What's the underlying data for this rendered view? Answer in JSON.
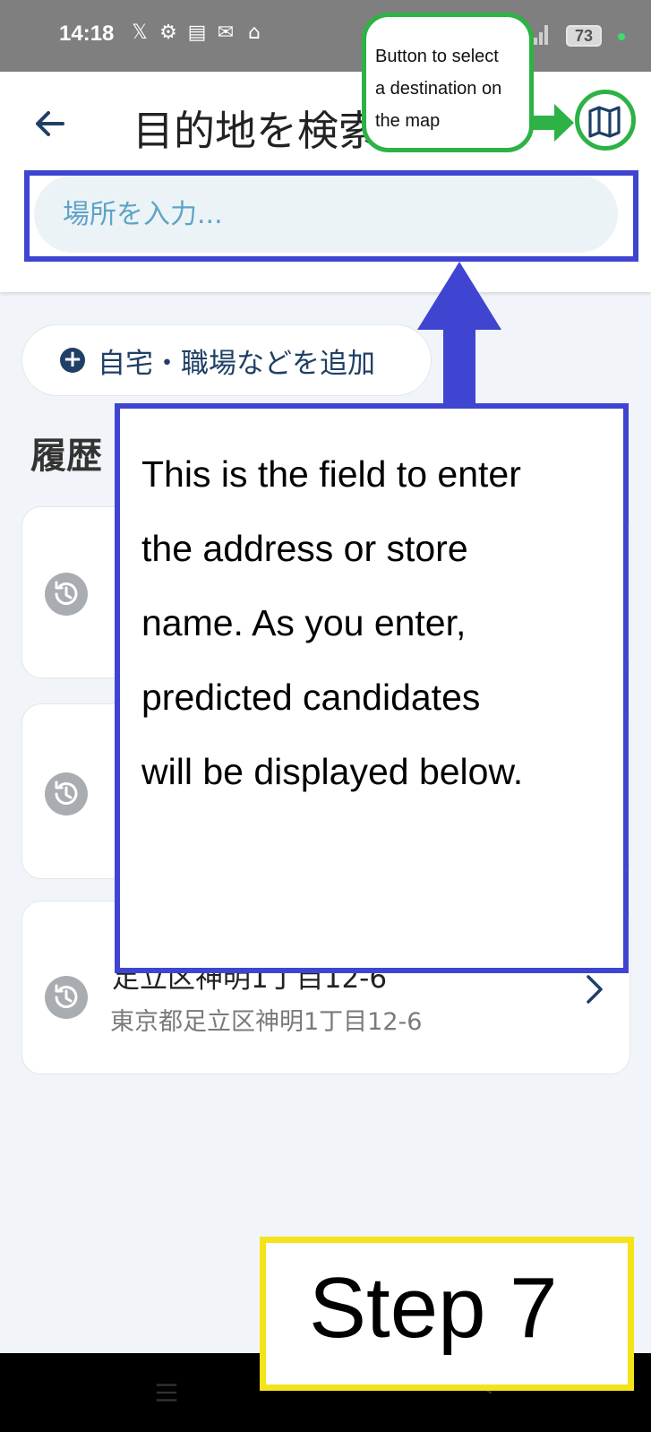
{
  "status_bar": {
    "time": "14:18",
    "icons": [
      "x-icon",
      "settings-icon",
      "sim-icon",
      "mail-icon",
      "vpn-icon"
    ],
    "battery": "73"
  },
  "header": {
    "title": "目的地を検索",
    "search_placeholder": "場所を入力..."
  },
  "content": {
    "add_place_label": "自宅・職場などを追加",
    "history_title": "履歴",
    "history_items": [
      {
        "primary": "",
        "secondary": ""
      },
      {
        "primary": "",
        "secondary": ""
      },
      {
        "primary": "足立区神明1丁目12-6",
        "secondary": "東京都足立区神明1丁目12-6"
      }
    ]
  },
  "annotations": {
    "map_button_note": [
      "Button to select",
      "a destination on",
      "the map"
    ],
    "field_note": [
      "This is the field to enter",
      "the address or store",
      "name. As you enter,",
      "predicted candidates",
      "will be displayed below."
    ],
    "step_label": "Step 7"
  },
  "colors": {
    "accent_dark_blue": "#1f3f66",
    "annotation_green": "#2db245",
    "annotation_blue": "#3f45d0",
    "annotation_yellow": "#f5e31a",
    "placeholder_blue": "#5fa3c6"
  }
}
